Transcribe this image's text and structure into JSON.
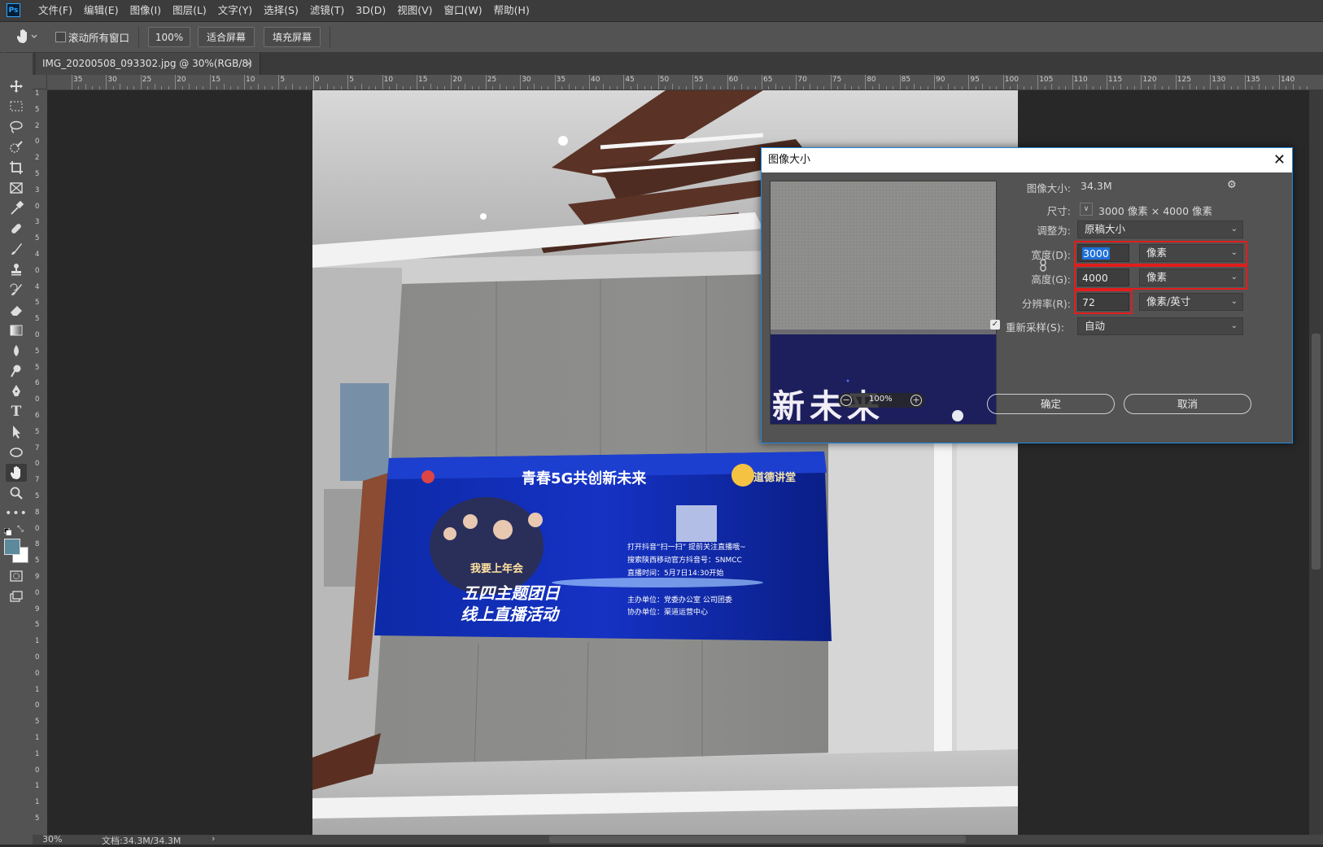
{
  "app": {
    "logo": "Ps"
  },
  "menu": [
    "文件(F)",
    "编辑(E)",
    "图像(I)",
    "图层(L)",
    "文字(Y)",
    "选择(S)",
    "滤镜(T)",
    "3D(D)",
    "视图(V)",
    "窗口(W)",
    "帮助(H)"
  ],
  "options": {
    "scroll_all_label": "滚动所有窗口",
    "zoom_btn": "100%",
    "fit_btn": "适合屏幕",
    "fill_btn": "填充屏幕"
  },
  "tab": {
    "title": "IMG_20200508_093302.jpg @ 30%(RGB/8) *",
    "close": "×"
  },
  "ruler": {
    "top": [
      "35",
      "30",
      "25",
      "20",
      "15",
      "10",
      "5",
      "0",
      "5",
      "10",
      "15",
      "20",
      "25",
      "30",
      "35",
      "40",
      "45",
      "50",
      "55",
      "60",
      "65",
      "70",
      "75",
      "80",
      "85",
      "90",
      "95",
      "100",
      "105",
      "110",
      "115",
      "120",
      "125",
      "130",
      "135",
      "140"
    ],
    "left": [
      "1",
      "5",
      "2",
      "0",
      "2",
      "5",
      "3",
      "0",
      "3",
      "5",
      "4",
      "0",
      "4",
      "5",
      "5",
      "0",
      "5",
      "5",
      "6",
      "0",
      "6",
      "5",
      "7",
      "0",
      "7",
      "5",
      "8",
      "0",
      "8",
      "5",
      "9",
      "0",
      "9",
      "5",
      "1",
      "0",
      "0",
      "1",
      "0",
      "5",
      "1",
      "1",
      "0",
      "1",
      "1",
      "5"
    ]
  },
  "photo": {
    "banner_headline": "青春5G共创新未来",
    "banner_logo_text": "道德讲堂",
    "banner_sub": "我要上年会",
    "banner_title1": "五四主题团日",
    "banner_title2": "线上直播活动",
    "banner_info1": "打开抖音“扫一扫”  提前关注直播哦~",
    "banner_info2": "搜索陕西移动官方抖音号：SNMCC",
    "banner_info3": "直播时间：5月7日14:30开始",
    "banner_host": "主办单位：党委办公室   公司团委",
    "banner_cohost": "协办单位：渠道运营中心"
  },
  "dialog": {
    "title": "图像大小",
    "close": "✕",
    "image_size_label": "图像大小:",
    "image_size_value": "34.3M",
    "dims_label": "尺寸:",
    "dims_value": "3000 像素 × 4000 像素",
    "fit_label": "调整为:",
    "fit_value": "原稿大小",
    "width_label": "宽度(D):",
    "width_value": "3000",
    "width_unit": "像素",
    "height_label": "高度(G):",
    "height_value": "4000",
    "height_unit": "像素",
    "res_label": "分辨率(R):",
    "res_value": "72",
    "res_unit": "像素/英寸",
    "resample_label": "重新采样(S):",
    "resample_value": "自动",
    "ok": "确定",
    "cancel": "取消",
    "preview_zoom": "100%",
    "preview_text": "新未来"
  },
  "status": {
    "zoom": "30%",
    "doc": "文档:34.3M/34.3M",
    "arrow": "›"
  },
  "colors": {
    "accent": "#1e88e5",
    "highlight": "#e11d1d"
  }
}
